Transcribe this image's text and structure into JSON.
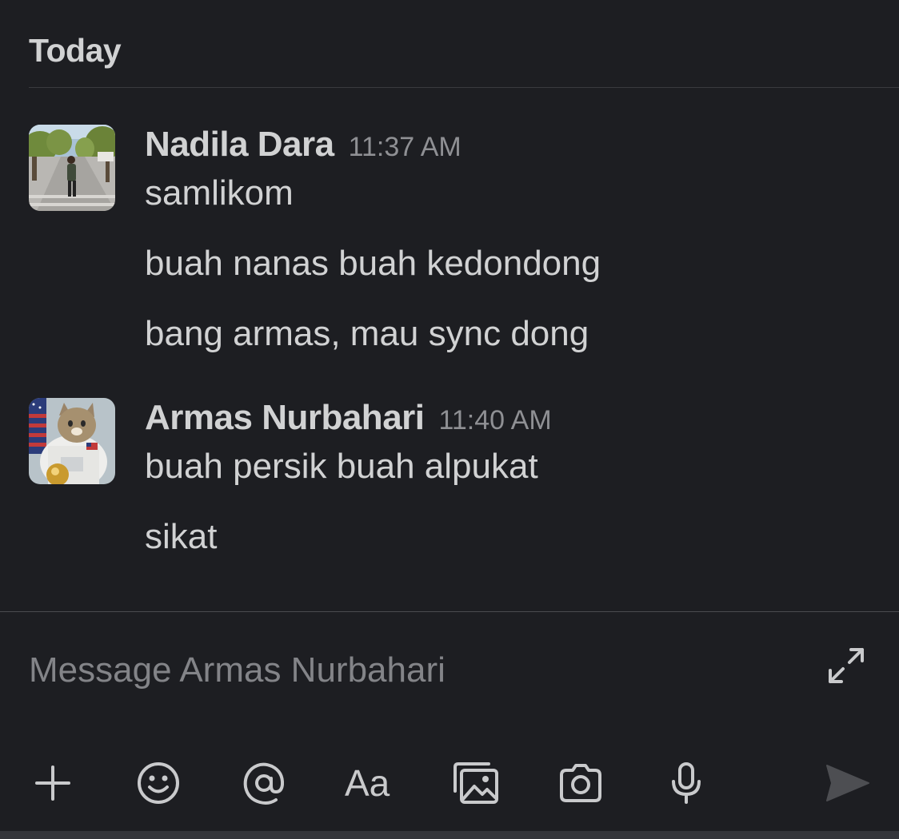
{
  "day_header": "Today",
  "messages": [
    {
      "sender": "Nadila Dara",
      "time": "11:37 AM",
      "lines": [
        "samlikom",
        "buah nanas buah kedondong",
        "bang armas, mau sync dong"
      ]
    },
    {
      "sender": "Armas Nurbahari",
      "time": "11:40 AM",
      "lines": [
        "buah persik buah alpukat",
        "sikat"
      ]
    }
  ],
  "composer": {
    "placeholder": "Message Armas Nurbahari"
  },
  "toolbar": {
    "format_label": "Aa",
    "icons": [
      "plus-icon",
      "emoji-icon",
      "mention-icon",
      "format-icon",
      "gallery-icon",
      "camera-icon",
      "microphone-icon",
      "send-icon"
    ]
  },
  "colors": {
    "background": "#1d1e22",
    "text": "#d1d2d3",
    "timestamp": "#8f9094",
    "placeholder": "#838488"
  }
}
